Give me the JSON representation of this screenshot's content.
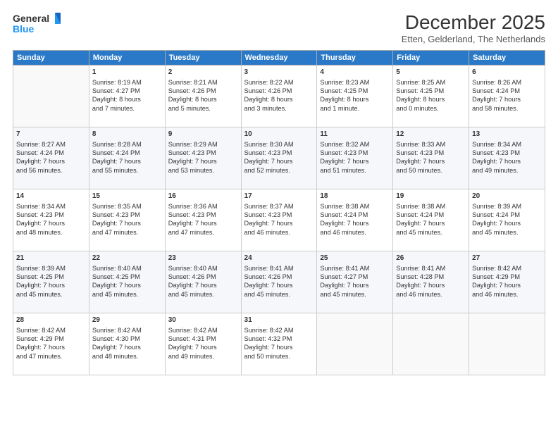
{
  "header": {
    "logo_general": "General",
    "logo_blue": "Blue",
    "title": "December 2025",
    "location": "Etten, Gelderland, The Netherlands"
  },
  "days_of_week": [
    "Sunday",
    "Monday",
    "Tuesday",
    "Wednesday",
    "Thursday",
    "Friday",
    "Saturday"
  ],
  "weeks": [
    [
      {
        "day": "",
        "info": ""
      },
      {
        "day": "1",
        "info": "Sunrise: 8:19 AM\nSunset: 4:27 PM\nDaylight: 8 hours\nand 7 minutes."
      },
      {
        "day": "2",
        "info": "Sunrise: 8:21 AM\nSunset: 4:26 PM\nDaylight: 8 hours\nand 5 minutes."
      },
      {
        "day": "3",
        "info": "Sunrise: 8:22 AM\nSunset: 4:26 PM\nDaylight: 8 hours\nand 3 minutes."
      },
      {
        "day": "4",
        "info": "Sunrise: 8:23 AM\nSunset: 4:25 PM\nDaylight: 8 hours\nand 1 minute."
      },
      {
        "day": "5",
        "info": "Sunrise: 8:25 AM\nSunset: 4:25 PM\nDaylight: 8 hours\nand 0 minutes."
      },
      {
        "day": "6",
        "info": "Sunrise: 8:26 AM\nSunset: 4:24 PM\nDaylight: 7 hours\nand 58 minutes."
      }
    ],
    [
      {
        "day": "7",
        "info": "Sunrise: 8:27 AM\nSunset: 4:24 PM\nDaylight: 7 hours\nand 56 minutes."
      },
      {
        "day": "8",
        "info": "Sunrise: 8:28 AM\nSunset: 4:24 PM\nDaylight: 7 hours\nand 55 minutes."
      },
      {
        "day": "9",
        "info": "Sunrise: 8:29 AM\nSunset: 4:23 PM\nDaylight: 7 hours\nand 53 minutes."
      },
      {
        "day": "10",
        "info": "Sunrise: 8:30 AM\nSunset: 4:23 PM\nDaylight: 7 hours\nand 52 minutes."
      },
      {
        "day": "11",
        "info": "Sunrise: 8:32 AM\nSunset: 4:23 PM\nDaylight: 7 hours\nand 51 minutes."
      },
      {
        "day": "12",
        "info": "Sunrise: 8:33 AM\nSunset: 4:23 PM\nDaylight: 7 hours\nand 50 minutes."
      },
      {
        "day": "13",
        "info": "Sunrise: 8:34 AM\nSunset: 4:23 PM\nDaylight: 7 hours\nand 49 minutes."
      }
    ],
    [
      {
        "day": "14",
        "info": "Sunrise: 8:34 AM\nSunset: 4:23 PM\nDaylight: 7 hours\nand 48 minutes."
      },
      {
        "day": "15",
        "info": "Sunrise: 8:35 AM\nSunset: 4:23 PM\nDaylight: 7 hours\nand 47 minutes."
      },
      {
        "day": "16",
        "info": "Sunrise: 8:36 AM\nSunset: 4:23 PM\nDaylight: 7 hours\nand 47 minutes."
      },
      {
        "day": "17",
        "info": "Sunrise: 8:37 AM\nSunset: 4:23 PM\nDaylight: 7 hours\nand 46 minutes."
      },
      {
        "day": "18",
        "info": "Sunrise: 8:38 AM\nSunset: 4:24 PM\nDaylight: 7 hours\nand 46 minutes."
      },
      {
        "day": "19",
        "info": "Sunrise: 8:38 AM\nSunset: 4:24 PM\nDaylight: 7 hours\nand 45 minutes."
      },
      {
        "day": "20",
        "info": "Sunrise: 8:39 AM\nSunset: 4:24 PM\nDaylight: 7 hours\nand 45 minutes."
      }
    ],
    [
      {
        "day": "21",
        "info": "Sunrise: 8:39 AM\nSunset: 4:25 PM\nDaylight: 7 hours\nand 45 minutes."
      },
      {
        "day": "22",
        "info": "Sunrise: 8:40 AM\nSunset: 4:25 PM\nDaylight: 7 hours\nand 45 minutes."
      },
      {
        "day": "23",
        "info": "Sunrise: 8:40 AM\nSunset: 4:26 PM\nDaylight: 7 hours\nand 45 minutes."
      },
      {
        "day": "24",
        "info": "Sunrise: 8:41 AM\nSunset: 4:26 PM\nDaylight: 7 hours\nand 45 minutes."
      },
      {
        "day": "25",
        "info": "Sunrise: 8:41 AM\nSunset: 4:27 PM\nDaylight: 7 hours\nand 45 minutes."
      },
      {
        "day": "26",
        "info": "Sunrise: 8:41 AM\nSunset: 4:28 PM\nDaylight: 7 hours\nand 46 minutes."
      },
      {
        "day": "27",
        "info": "Sunrise: 8:42 AM\nSunset: 4:29 PM\nDaylight: 7 hours\nand 46 minutes."
      }
    ],
    [
      {
        "day": "28",
        "info": "Sunrise: 8:42 AM\nSunset: 4:29 PM\nDaylight: 7 hours\nand 47 minutes."
      },
      {
        "day": "29",
        "info": "Sunrise: 8:42 AM\nSunset: 4:30 PM\nDaylight: 7 hours\nand 48 minutes."
      },
      {
        "day": "30",
        "info": "Sunrise: 8:42 AM\nSunset: 4:31 PM\nDaylight: 7 hours\nand 49 minutes."
      },
      {
        "day": "31",
        "info": "Sunrise: 8:42 AM\nSunset: 4:32 PM\nDaylight: 7 hours\nand 50 minutes."
      },
      {
        "day": "",
        "info": ""
      },
      {
        "day": "",
        "info": ""
      },
      {
        "day": "",
        "info": ""
      }
    ]
  ]
}
